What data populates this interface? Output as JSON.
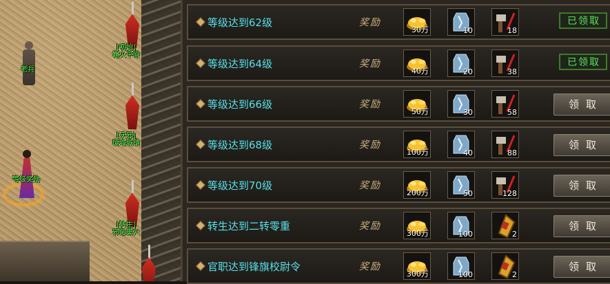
{
  "npcs": [
    {
      "label_lines": [
        "老兵"
      ]
    },
    {
      "label_lines": [
        "[初始]",
        "霜火平原"
      ]
    },
    {
      "label_lines": [
        "[沃邪]",
        "废墟城镇"
      ]
    },
    {
      "label_lines": [
        "等级奖励"
      ]
    },
    {
      "label_lines": [
        "[转生]",
        "邪恶巢穴"
      ]
    }
  ],
  "reward_label": "奖励",
  "rows": [
    {
      "title": "等级达到62级",
      "gold": "30万",
      "gem": "10",
      "item": "18",
      "item_icon": "hammer-icon",
      "status": "done",
      "button": "已领取"
    },
    {
      "title": "等级达到64级",
      "gold": "40万",
      "gem": "20",
      "item": "38",
      "item_icon": "hammer-icon",
      "status": "done",
      "button": "已领取"
    },
    {
      "title": "等级达到66级",
      "gold": "50万",
      "gem": "30",
      "item": "58",
      "item_icon": "hammer-icon",
      "status": "claim",
      "button": "领取"
    },
    {
      "title": "等级达到68级",
      "gold": "100万",
      "gem": "40",
      "item": "88",
      "item_icon": "hammer-icon",
      "status": "claim",
      "button": "领取"
    },
    {
      "title": "等级达到70级",
      "gold": "200万",
      "gem": "50",
      "item": "128",
      "item_icon": "hammer-icon",
      "status": "claim",
      "button": "领取"
    },
    {
      "title": "转生达到二转零重",
      "gold": "300万",
      "gem": "100",
      "item": "2",
      "item_icon": "token-icon",
      "status": "claim",
      "button": "领取"
    },
    {
      "title": "官职达到锋旗校尉令",
      "gold": "300万",
      "gem": "100",
      "item": "2",
      "item_icon": "token-icon",
      "status": "claim",
      "button": "领取"
    }
  ],
  "colors": {
    "title": "#56e0e8",
    "npc_label": "#49ff49",
    "claimed": "#5ee25e"
  }
}
